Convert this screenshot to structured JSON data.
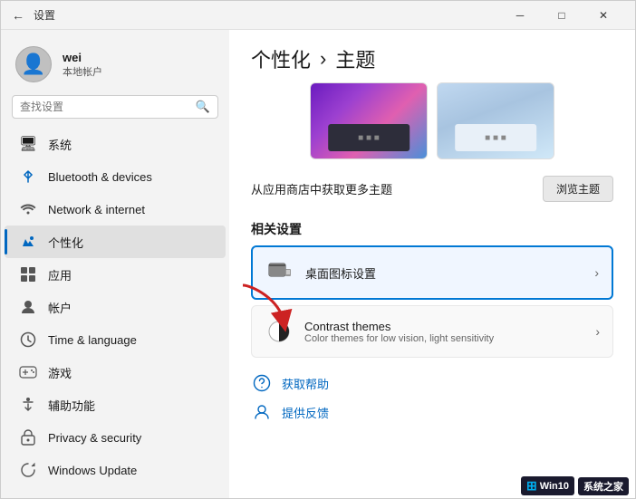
{
  "window": {
    "title": "设置",
    "controls": {
      "minimize": "─",
      "maximize": "□",
      "close": "✕"
    }
  },
  "sidebar": {
    "user": {
      "name": "wei",
      "type": "本地帐户"
    },
    "search": {
      "placeholder": "查找设置"
    },
    "nav_items": [
      {
        "id": "system",
        "label": "系统",
        "icon": "🖥"
      },
      {
        "id": "bluetooth",
        "label": "Bluetooth & devices",
        "icon": "🔵"
      },
      {
        "id": "network",
        "label": "Network & internet",
        "icon": "📶"
      },
      {
        "id": "personal",
        "label": "个性化",
        "icon": "🖌"
      },
      {
        "id": "apps",
        "label": "应用",
        "icon": "📦"
      },
      {
        "id": "accounts",
        "label": "帐户",
        "icon": "👤"
      },
      {
        "id": "time",
        "label": "Time & language",
        "icon": "🕐"
      },
      {
        "id": "gaming",
        "label": "游戏",
        "icon": "🎮"
      },
      {
        "id": "assist",
        "label": "辅助功能",
        "icon": "♿"
      },
      {
        "id": "privacy",
        "label": "Privacy & security",
        "icon": "🔒"
      },
      {
        "id": "winupdate",
        "label": "Windows Update",
        "icon": "⟳"
      }
    ]
  },
  "content": {
    "breadcrumb": {
      "parent": "个性化",
      "separator": "›",
      "current": "主题"
    },
    "get_themes": {
      "link_text": "从应用商店中获取更多主题",
      "button_label": "浏览主题"
    },
    "related": {
      "title": "相关设置",
      "items": [
        {
          "id": "desktop-icon",
          "title": "桌面图标设置",
          "subtitle": "",
          "icon": "🖥"
        },
        {
          "id": "contrast",
          "title": "Contrast themes",
          "subtitle": "Color themes for low vision, light sensitivity",
          "icon": "◑"
        }
      ]
    },
    "bottom_links": [
      {
        "id": "get-help",
        "text": "获取帮助",
        "icon": "💬"
      },
      {
        "id": "feedback",
        "text": "提供反馈",
        "icon": "👤"
      }
    ]
  },
  "watermark": {
    "text": "Win10",
    "subtext": "系统之家"
  }
}
